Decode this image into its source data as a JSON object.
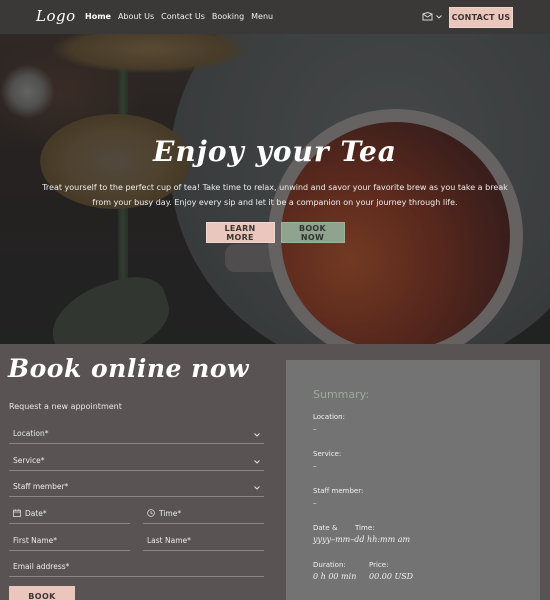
{
  "nav": {
    "logo": "Logo",
    "links": [
      {
        "label": "Home",
        "active": true
      },
      {
        "label": "About Us",
        "active": false
      },
      {
        "label": "Contact Us",
        "active": false
      },
      {
        "label": "Booking",
        "active": false
      },
      {
        "label": "Menu",
        "active": false
      }
    ],
    "icons": [
      "envelope-icon",
      "chevron-down-icon"
    ],
    "contact_button": "CONTACT US"
  },
  "hero": {
    "title": "Enjoy your Tea",
    "text": "Treat yourself to the perfect cup of tea! Take time to relax, unwind and savor your favorite brew as you take a break from your busy day. Enjoy every sip and let it be a companion on your journey through life.",
    "buttons": {
      "learn_more": "LEARN MORE",
      "book_now": "BOOK NOW"
    }
  },
  "booking": {
    "title": "Book online now",
    "subtitle": "Request a new appointment",
    "fields": {
      "location": "Location*",
      "service": "Service*",
      "staff": "Staff member*",
      "date": "Date*",
      "time": "Time*",
      "first_name": "First Name*",
      "last_name": "Last Name*",
      "email": "Email address*"
    },
    "submit": "BOOK"
  },
  "summary": {
    "title": "Summary:",
    "location_label": "Location:",
    "location_value": "–",
    "service_label": "Service:",
    "service_value": "–",
    "staff_label": "Staff member:",
    "staff_value": "–",
    "date_label": "Date &",
    "time_label": "Time:",
    "datetime_value": "yyyy–mm–dd hh:mm am",
    "duration_label": "Duration:",
    "duration_value": "0 h 00 min",
    "price_label": "Price:",
    "price_value": "00.00 USD"
  },
  "colors": {
    "nav_bg": "#3a3937",
    "page_bg": "#595453",
    "accent_pink": "#ebc6bd",
    "accent_green": "#8fa38f",
    "summary_bg": "#737373",
    "summary_title": "#9cab9a"
  }
}
